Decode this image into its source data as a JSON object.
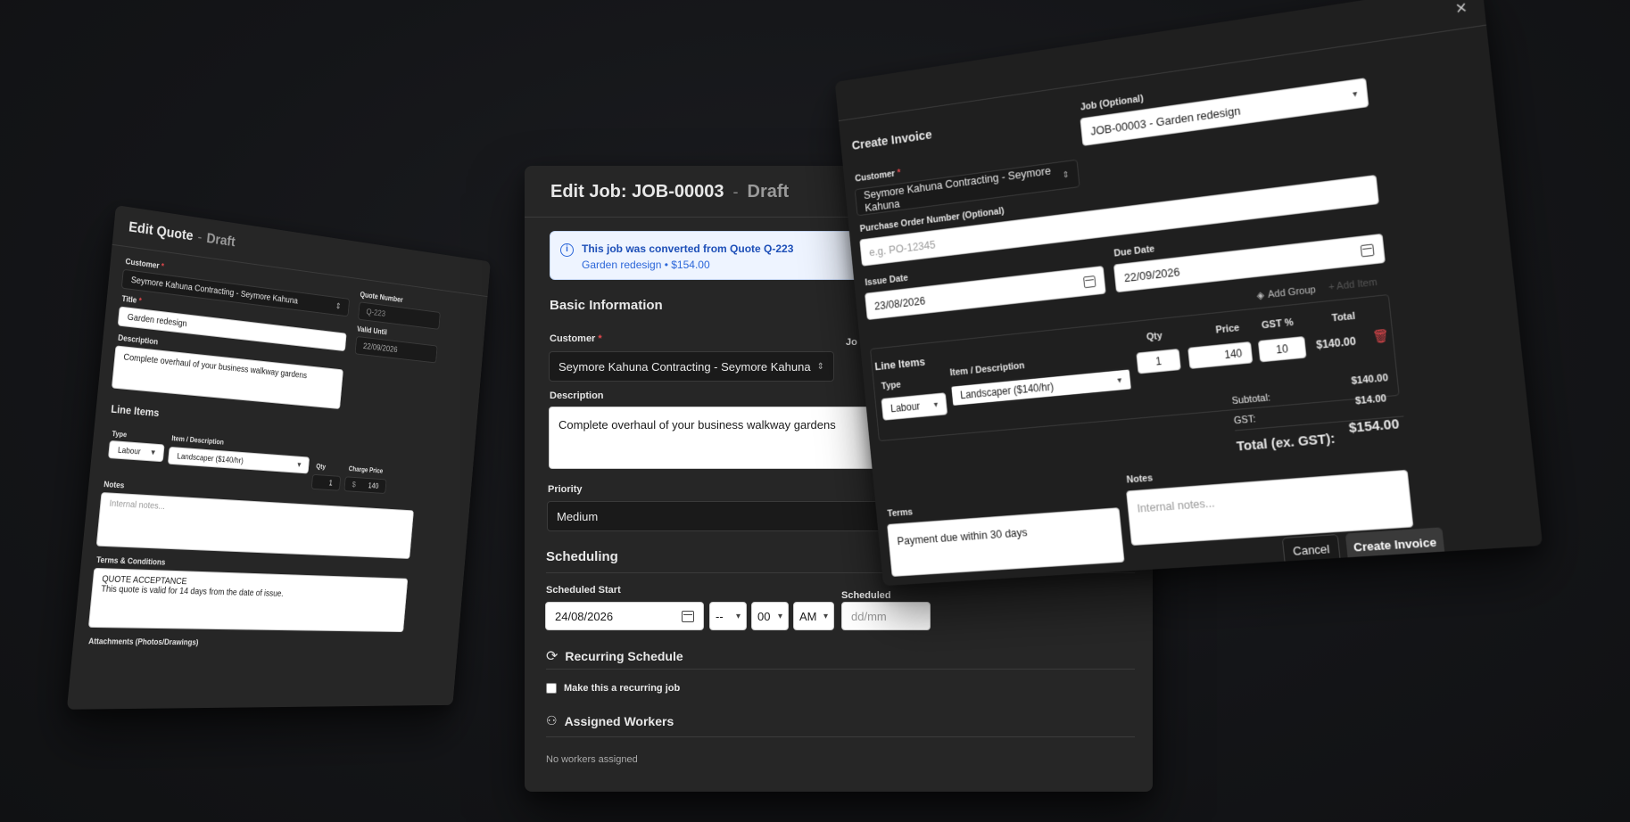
{
  "quote": {
    "title": "Edit Quote",
    "status": "Draft",
    "customer_label": "Customer",
    "customer_value": "Seymore Kahuna Contracting - Seymore Kahuna",
    "quote_number_label": "Quote Number",
    "quote_number_value": "Q-223",
    "title_label": "Title",
    "title_value": "Garden redesign",
    "valid_until_label": "Valid Until",
    "valid_until_value": "22/09/2026",
    "description_label": "Description",
    "description_value": "Complete overhaul of your business walkway gardens",
    "line_items_heading": "Line Items",
    "col_type": "Type",
    "col_item": "Item / Description",
    "col_qty": "Qty",
    "col_charge": "Charge Price",
    "row_type": "Labour",
    "row_item": "Landscaper ($140/hr)",
    "row_qty": "1",
    "row_currency": "$",
    "row_price": "140",
    "notes_label": "Notes",
    "notes_placeholder": "Internal notes...",
    "terms_label": "Terms & Conditions",
    "terms_line1": "QUOTE ACCEPTANCE",
    "terms_line2": "This quote is valid for 14 days from the date of issue.",
    "attachments_label": "Attachments (Photos/Drawings)"
  },
  "job": {
    "title": "Edit Job: JOB-00003",
    "status": "Draft",
    "alert_title": "This job was converted from Quote Q-223",
    "alert_sub": "Garden redesign • $154.00",
    "basic_info_heading": "Basic Information",
    "customer_label": "Customer",
    "customer_value": "Seymore Kahuna Contracting - Seymore Kahuna",
    "job_label_partial": "Jo",
    "description_label": "Description",
    "description_value": "Complete overhaul of your business walkway gardens",
    "priority_label": "Priority",
    "priority_value": "Medium",
    "scheduling_heading": "Scheduling",
    "sched_start_label": "Scheduled Start",
    "sched_start_date": "24/08/2026",
    "sched_hour": "--",
    "sched_minute": "00",
    "sched_ampm": "AM",
    "sched_end_label": "Scheduled",
    "sched_end_placeholder": "dd/mm",
    "recurring_heading": "Recurring Schedule",
    "recurring_checkbox": "Make this a recurring job",
    "workers_heading": "Assigned Workers",
    "workers_empty": "No workers assigned"
  },
  "invoice": {
    "title": "Create Invoice",
    "close": "×",
    "customer_label": "Customer",
    "customer_value": "Seymore Kahuna Contracting - Seymore Kahuna",
    "job_label": "Job (Optional)",
    "job_value": "JOB-00003 - Garden redesign",
    "po_label": "Purchase Order Number (Optional)",
    "po_placeholder": "e.g. PO-12345",
    "issue_label": "Issue Date",
    "issue_value": "23/08/2026",
    "due_label": "Due Date",
    "due_value": "22/09/2026",
    "line_items_heading": "Line Items",
    "add_group": "Add Group",
    "add_item": "+ Add Item",
    "col_type": "Type",
    "col_item": "Item / Description",
    "col_qty": "Qty",
    "col_price": "Price",
    "col_gst": "GST %",
    "col_total": "Total",
    "row_type": "Labour",
    "row_item": "Landscaper ($140/hr)",
    "row_qty": "1",
    "row_price": "140",
    "row_gst": "10",
    "row_total": "$140.00",
    "subtotal_label": "Subtotal:",
    "subtotal_value": "$140.00",
    "gst_label": "GST:",
    "gst_value": "$14.00",
    "total_label": "Total (ex. GST):",
    "total_value": "$154.00",
    "terms_label": "Terms",
    "terms_value": "Payment due within 30 days",
    "notes_label": "Notes",
    "notes_placeholder": "Internal notes...",
    "cancel": "Cancel",
    "create": "Create Invoice"
  }
}
